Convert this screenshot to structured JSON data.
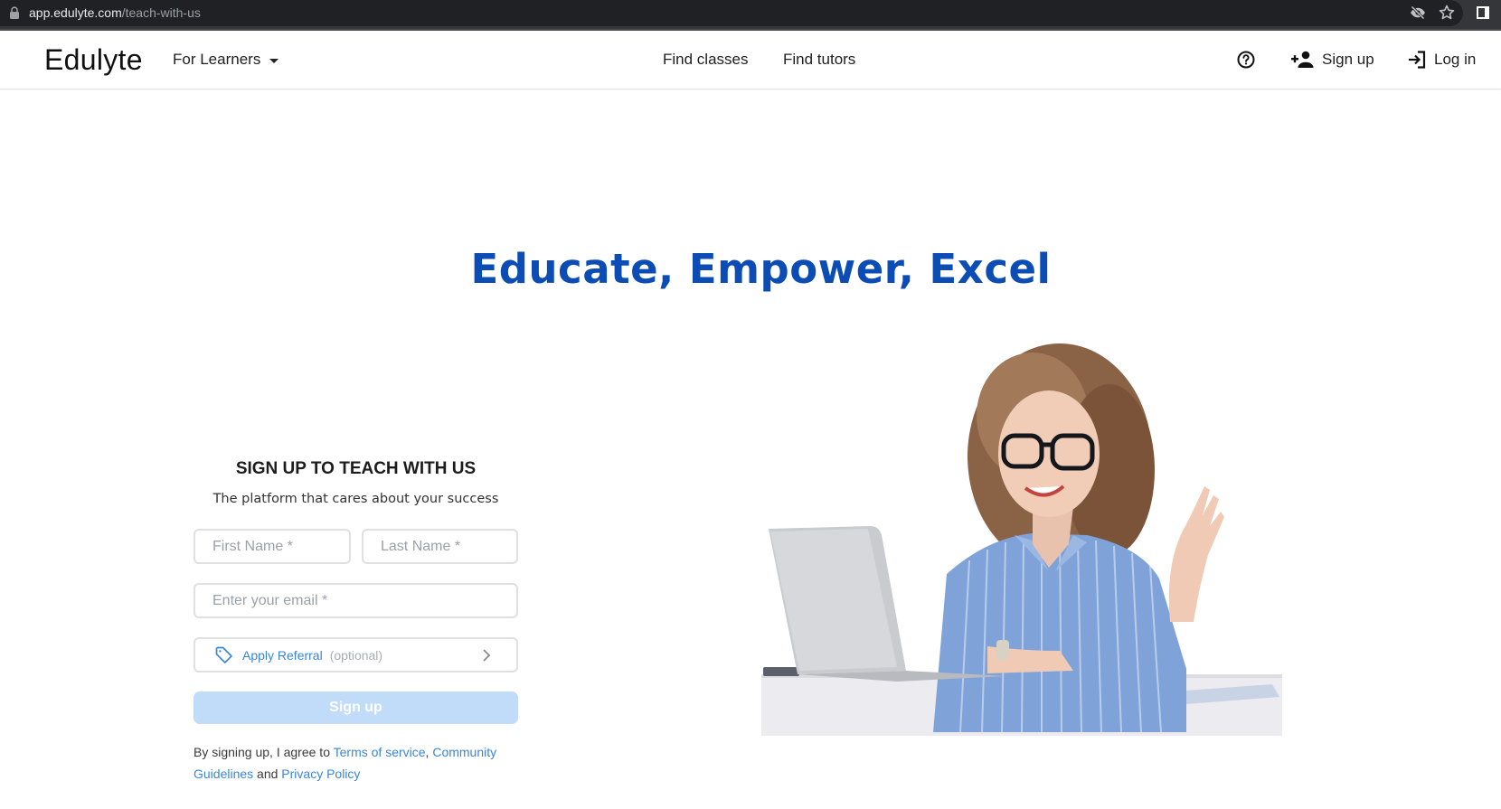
{
  "browser": {
    "url_host": "app.edulyte.com",
    "url_path": "/teach-with-us",
    "icons": [
      "lock-icon",
      "eye-off-icon",
      "star-icon",
      "sidebar-icon"
    ]
  },
  "header": {
    "logo": "Edulyte",
    "audience_menu": "For Learners",
    "nav": {
      "find_classes": "Find classes",
      "find_tutors": "Find tutors"
    },
    "help_icon": "help-circle-icon",
    "sign_up": "Sign up",
    "log_in": "Log in"
  },
  "hero": {
    "title": "Educate, Empower, Excel",
    "image_alt": "Smiling woman with glasses and curly hair waving at a laptop"
  },
  "signup_form": {
    "heading": "SIGN UP TO TEACH WITH US",
    "subtitle": "The platform that cares about your success",
    "first_name_placeholder": "First Name *",
    "last_name_placeholder": "Last Name *",
    "email_placeholder": "Enter your email *",
    "first_name_value": "",
    "last_name_value": "",
    "email_value": "",
    "referral_label": "Apply Referral",
    "referral_optional": "(optional)",
    "submit_label": "Sign up",
    "submit_enabled": false,
    "terms": {
      "prefix": "By signing up, I agree to ",
      "terms_link": "Terms of service",
      "sep": ", ",
      "guidelines_link": "Community Guidelines",
      "and": " and ",
      "privacy_link": "Privacy Policy"
    }
  },
  "colors": {
    "brand_blue": "#0b4db5",
    "link_blue": "#3a86d6",
    "button_disabled": "#c1dcf8",
    "field_border": "#e0e0e0"
  }
}
